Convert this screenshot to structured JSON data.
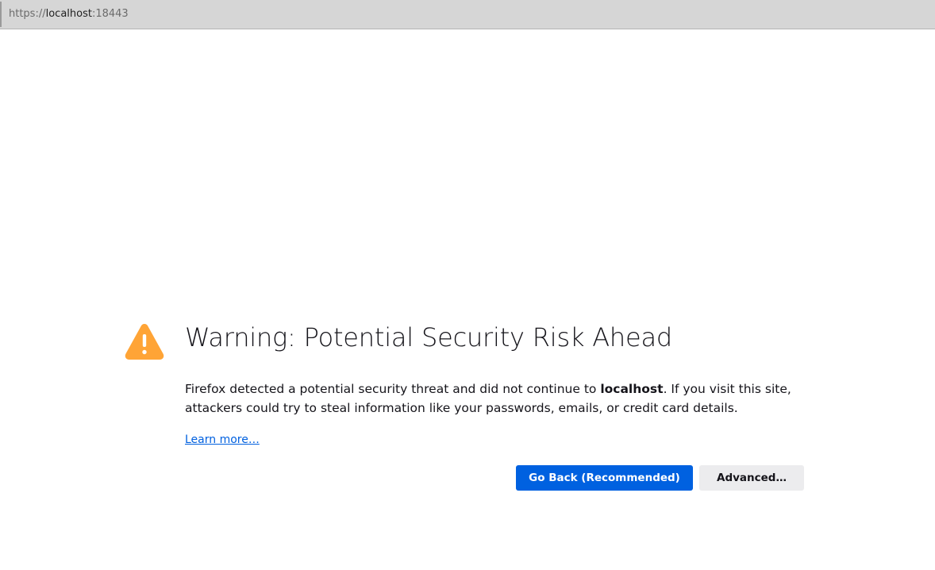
{
  "urlbar": {
    "scheme": "https://",
    "host": "localhost",
    "port": ":18443"
  },
  "error": {
    "title": "Warning: Potential Security Risk Ahead",
    "description_before": "Firefox detected a potential security threat and did not continue to ",
    "description_host": "localhost",
    "description_after": ". If you visit this site, attackers could try to steal information like your passwords, emails, or credit card details.",
    "learn_more": "Learn more…",
    "icon": "warning-triangle-icon"
  },
  "buttons": {
    "go_back": "Go Back (Recommended)",
    "advanced": "Advanced…"
  },
  "colors": {
    "warning_icon": "#ffa436",
    "primary_button": "#0061e0",
    "link": "#0060df"
  }
}
